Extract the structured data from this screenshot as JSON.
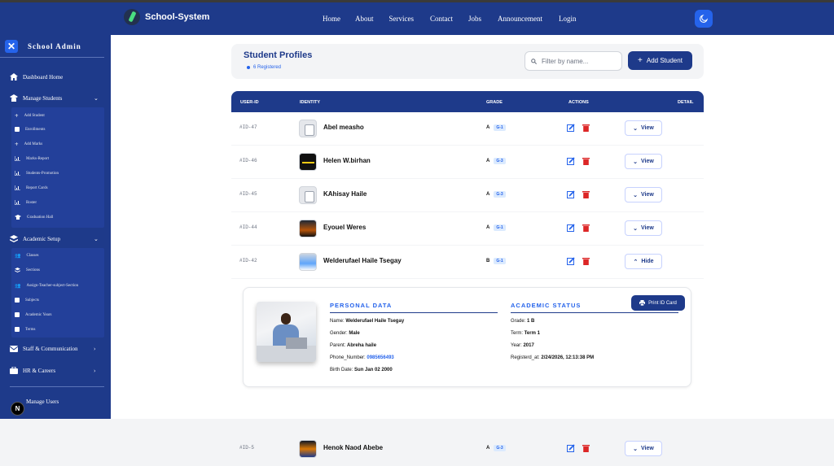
{
  "brand": {
    "name": "School-System"
  },
  "nav": [
    "Home",
    "About",
    "Services",
    "Contact",
    "Jobs",
    "Announcement",
    "Login"
  ],
  "sidebar": {
    "title": "School Admin",
    "items": [
      {
        "label": "Dashboard Home",
        "icon": "home-icon"
      },
      {
        "label": "Manage Students",
        "icon": "graduate-icon"
      },
      {
        "label": "Academic Setup",
        "icon": "layers-icon"
      },
      {
        "label": "Staff & Communication",
        "icon": "mail-icon"
      },
      {
        "label": "HR & Careers",
        "icon": "briefcase-icon"
      },
      {
        "label": "Manage Users",
        "icon": "user-icon"
      }
    ],
    "students_sub": [
      "Add Student",
      "Enrollments",
      "Add Marks",
      "Marks-Report",
      "Students-Promotion",
      "Report Cards",
      "Roster",
      "Graduation Hall"
    ],
    "academic_sub": [
      "Classes",
      "Sections",
      "Assign-Teacher-subject-Section",
      "Subjects",
      "Academic Years",
      "Terms"
    ]
  },
  "header": {
    "title": "Student Profiles",
    "count": "6 Registered",
    "filter_placeholder": "Filter by name...",
    "add_label": "Add Student"
  },
  "table": {
    "columns": [
      "USER-ID",
      "IDENTITY",
      "GRADE",
      "ACTIONS",
      "DETAIL"
    ],
    "rows": [
      {
        "id": "#ID-47",
        "name": "Abel measho",
        "grade": "A",
        "badge": "G-1",
        "action": "View"
      },
      {
        "id": "#ID-46",
        "name": "Helen W.birhan",
        "grade": "A",
        "badge": "G-3",
        "action": "View"
      },
      {
        "id": "#ID-45",
        "name": "KAhisay Haile",
        "grade": "A",
        "badge": "G-3",
        "action": "View"
      },
      {
        "id": "#ID-44",
        "name": "Eyouel Weres",
        "grade": "A",
        "badge": "G-1",
        "action": "View"
      },
      {
        "id": "#ID-42",
        "name": "Welderufael Haile Tsegay",
        "grade": "B",
        "badge": "G-1",
        "action": "Hide"
      },
      {
        "id": "#ID-5",
        "name": "Henok Naod Abebe",
        "grade": "A",
        "badge": "G-3",
        "action": "View"
      }
    ]
  },
  "detail": {
    "personal_title": "PERSONAL DATA",
    "academic_title": "ACADEMIC STATUS",
    "print_label": "Print ID Card",
    "personal": [
      {
        "k": "Name:",
        "v": "Welderufael Haile Tsegay"
      },
      {
        "k": "Gender:",
        "v": "Male"
      },
      {
        "k": "Parent:",
        "v": "Abreha haile"
      },
      {
        "k": "Phone_Number:",
        "v": "0985656493"
      },
      {
        "k": "Birth Date:",
        "v": "Sun Jan 02 2000"
      }
    ],
    "academic": [
      {
        "k": "Grade:",
        "v": "1 B"
      },
      {
        "k": "Term:",
        "v": "Term 1"
      },
      {
        "k": "Year:",
        "v": "2017"
      },
      {
        "k": "Registerd_at:",
        "v": "2/24/2026, 12:13:38 PM"
      }
    ]
  },
  "devtools": {
    "badge": "N"
  }
}
